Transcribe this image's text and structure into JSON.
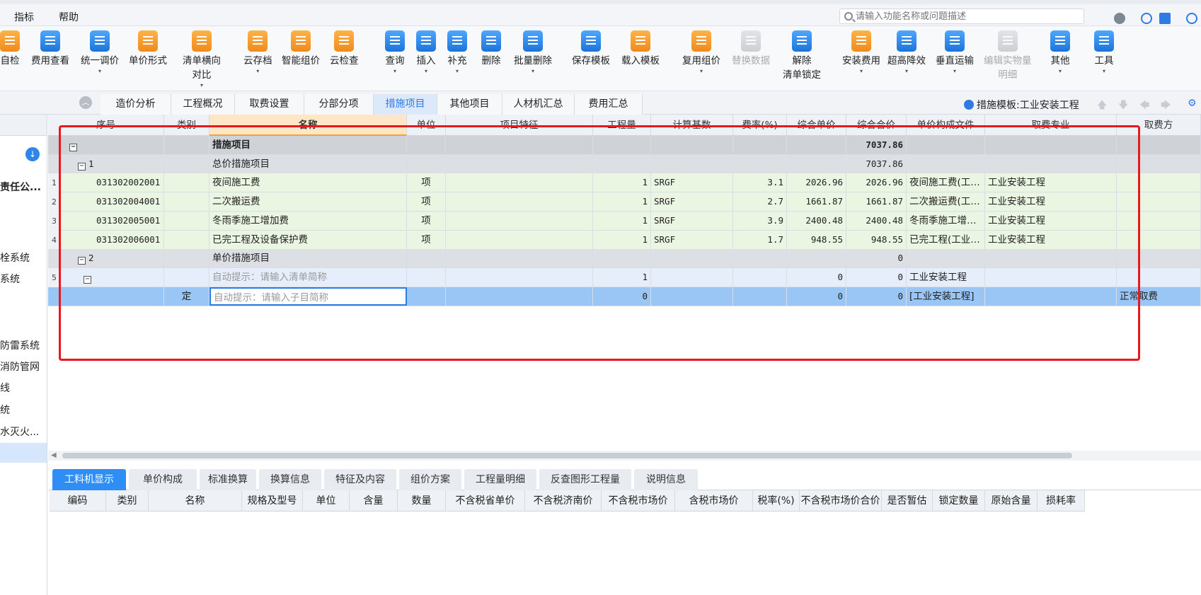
{
  "menu": {
    "items": [
      "指标",
      "帮助"
    ],
    "search_placeholder": "请输入功能名称或问题描述"
  },
  "toolbar": {
    "items": [
      {
        "label": "自检",
        "color": "orange"
      },
      {
        "label": "费用查看",
        "color": "blue"
      },
      {
        "label": "统一调价",
        "color": "blue",
        "dropdown": "▾"
      },
      {
        "label": "单价形式",
        "color": "orange"
      },
      {
        "label": "清单横向",
        "label2": "对比",
        "color": "orange",
        "dropdown": "▾"
      },
      {
        "label": "云存档",
        "color": "orange",
        "dropdown": "▾"
      },
      {
        "label": "智能组价",
        "color": "orange"
      },
      {
        "label": "云检查",
        "color": "orange"
      },
      {
        "label": "查询",
        "color": "blue",
        "dropdown": "▾"
      },
      {
        "label": "插入",
        "color": "blue",
        "dropdown": "▾"
      },
      {
        "label": "补充",
        "color": "blue",
        "dropdown": "▾"
      },
      {
        "label": "删除",
        "color": "blue"
      },
      {
        "label": "批量删除",
        "color": "blue",
        "dropdown": "▾"
      },
      {
        "label": "保存模板",
        "color": "blue"
      },
      {
        "label": "载入模板",
        "color": "orange"
      },
      {
        "label": "复用组价",
        "color": "orange",
        "dropdown": "▾"
      },
      {
        "label": "替换数据",
        "color": "gray",
        "disabled": true
      },
      {
        "label": "解除",
        "label2": "清单锁定",
        "color": "blue"
      },
      {
        "label": "安装费用",
        "color": "orange",
        "dropdown": "▾"
      },
      {
        "label": "超高降效",
        "color": "blue",
        "dropdown": "▾"
      },
      {
        "label": "垂直运输",
        "color": "blue",
        "dropdown": "▾"
      },
      {
        "label": "编辑实物量",
        "label2": "明细",
        "color": "gray",
        "disabled": true
      },
      {
        "label": "其他",
        "color": "blue",
        "dropdown": "▾"
      },
      {
        "label": "工具",
        "color": "blue",
        "dropdown": "▾"
      }
    ]
  },
  "tabs": [
    "造价分析",
    "工程概况",
    "取费设置",
    "分部分项",
    "措施项目",
    "其他项目",
    "人材机汇总",
    "费用汇总"
  ],
  "active_tab": "措施项目",
  "template": {
    "label": "措施模板:工业安装工程"
  },
  "left_panel": {
    "items": [
      "责任公...",
      "栓系统",
      "系统",
      "防雷系统",
      "消防管网",
      "线",
      "统",
      "水灭火..."
    ]
  },
  "grid": {
    "columns": [
      "序号",
      "类别",
      "名称",
      "单位",
      "项目特征",
      "工程量",
      "计算基数",
      "费率(%)",
      "综合单价",
      "综合合价",
      "单价构成文件",
      "取费专业",
      "取费方"
    ],
    "rows": [
      {
        "kind": "lvl0",
        "seq": "",
        "cat": "",
        "name": "措施项目",
        "unit": "",
        "qty": "",
        "base": "",
        "rate": "",
        "uprice": "",
        "total": "7037.86",
        "file": "",
        "major": "",
        "fee": ""
      },
      {
        "kind": "lvl1",
        "seq": "1",
        "cat": "",
        "name": "总价措施项目",
        "unit": "",
        "qty": "",
        "base": "",
        "rate": "",
        "uprice": "",
        "total": "7037.86",
        "file": "",
        "major": "",
        "fee": ""
      },
      {
        "kind": "item",
        "rownum": "1",
        "seq": "031302002001",
        "cat": "",
        "name": "夜间施工费",
        "unit": "项",
        "qty": "1",
        "base": "SRGF",
        "rate": "3.1",
        "uprice": "2026.96",
        "total": "2026.96",
        "file": "夜间施工费(工…",
        "major": "工业安装工程",
        "fee": ""
      },
      {
        "kind": "item",
        "rownum": "2",
        "seq": "031302004001",
        "cat": "",
        "name": "二次搬运费",
        "unit": "项",
        "qty": "1",
        "base": "SRGF",
        "rate": "2.7",
        "uprice": "1661.87",
        "total": "1661.87",
        "file": "二次搬运费(工…",
        "major": "工业安装工程",
        "fee": ""
      },
      {
        "kind": "item",
        "rownum": "3",
        "seq": "031302005001",
        "cat": "",
        "name": "冬雨季施工增加费",
        "unit": "项",
        "qty": "1",
        "base": "SRGF",
        "rate": "3.9",
        "uprice": "2400.48",
        "total": "2400.48",
        "file": "冬雨季施工增…",
        "major": "工业安装工程",
        "fee": ""
      },
      {
        "kind": "item",
        "rownum": "4",
        "seq": "031302006001",
        "cat": "",
        "name": "已完工程及设备保护费",
        "unit": "项",
        "qty": "1",
        "base": "SRGF",
        "rate": "1.7",
        "uprice": "948.55",
        "total": "948.55",
        "file": "已完工程(工业…",
        "major": "工业安装工程",
        "fee": ""
      },
      {
        "kind": "lvl1",
        "seq": "2",
        "cat": "",
        "name": "单价措施项目",
        "unit": "",
        "qty": "",
        "base": "",
        "rate": "",
        "uprice": "",
        "total": "0",
        "file": "",
        "major": "",
        "fee": ""
      },
      {
        "kind": "sub",
        "rownum": "5",
        "seq": "",
        "cat": "",
        "name": "自动提示：请输入清单简称",
        "unit": "",
        "qty": "1",
        "base": "",
        "rate": "",
        "uprice": "0",
        "total": "0",
        "file": "工业安装工程",
        "major": "",
        "fee": ""
      },
      {
        "kind": "selected",
        "seq": "",
        "cat": "定",
        "name": "自动提示：请输入子目简称",
        "unit": "",
        "qty": "0",
        "base": "",
        "rate": "",
        "uprice": "0",
        "total": "0",
        "file": "[工业安装工程]",
        "major": "",
        "fee": "正常取费"
      }
    ]
  },
  "lower_tabs": [
    "工料机显示",
    "单价构成",
    "标准换算",
    "换算信息",
    "特征及内容",
    "组价方案",
    "工程量明细",
    "反查图形工程量",
    "说明信息"
  ],
  "lower_active": "工料机显示",
  "lower_columns": [
    "编码",
    "类别",
    "名称",
    "规格及型号",
    "单位",
    "含量",
    "数量",
    "不含税省单价",
    "不含税济南价",
    "不含税市场价",
    "含税市场价",
    "税率(%)",
    "不含税市场价合价",
    "是否暂估",
    "锁定数量",
    "原始含量",
    "损耗率"
  ],
  "colors": {
    "accent": "#2f7be5",
    "highlight": "#e8181d"
  }
}
